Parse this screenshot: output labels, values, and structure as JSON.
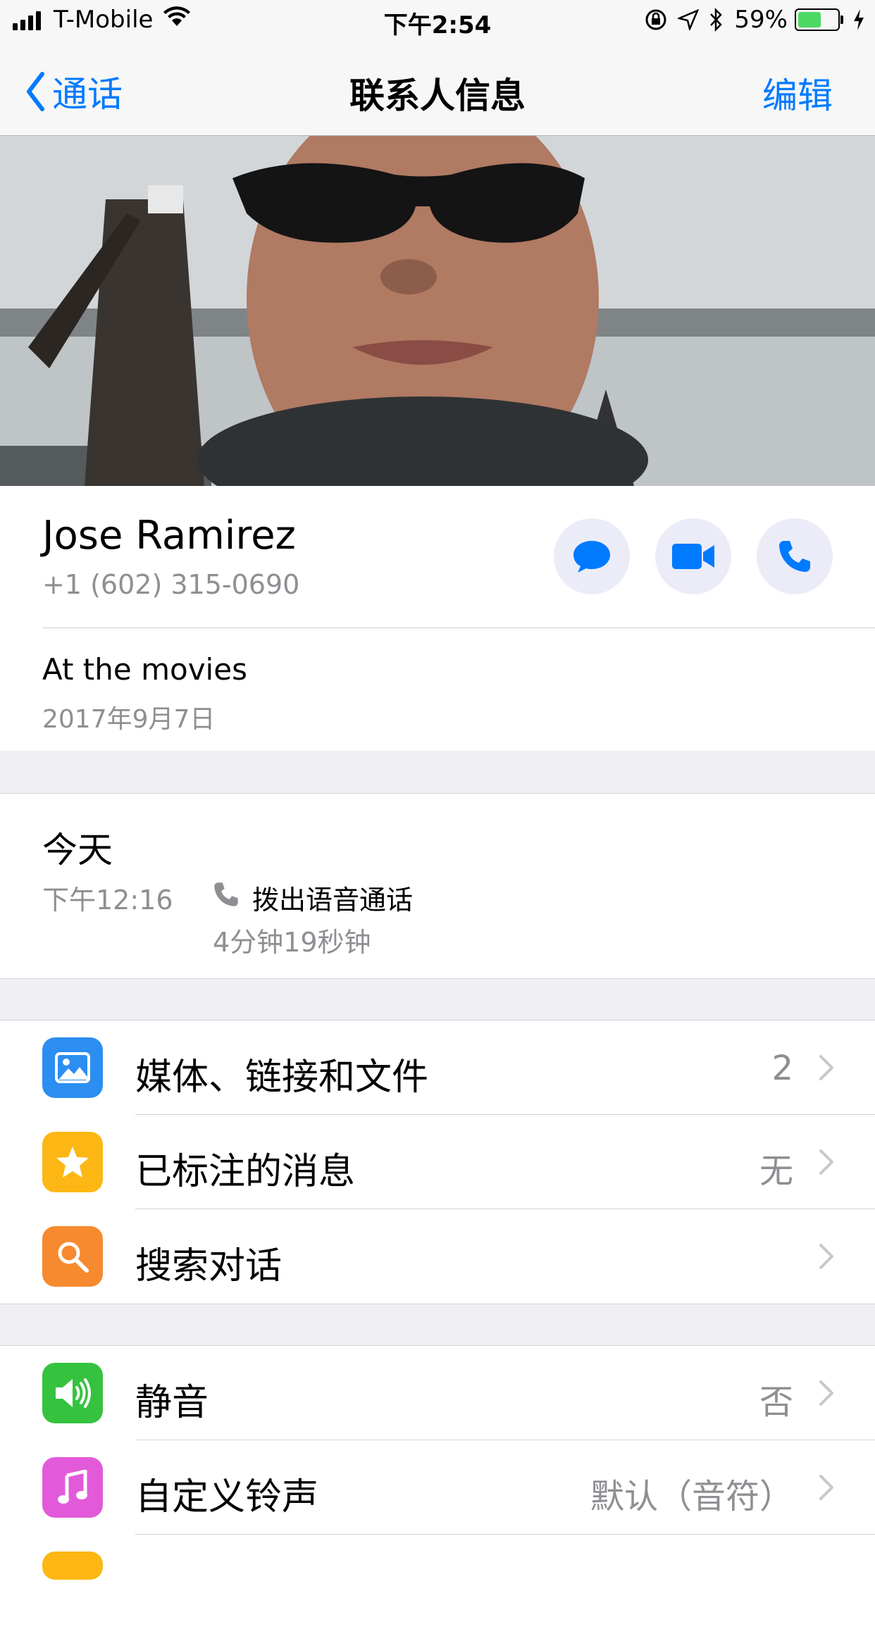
{
  "status_bar": {
    "carrier": "T-Mobile",
    "time": "下午2:54",
    "battery": "59%",
    "battery_level": 0.59
  },
  "nav": {
    "back_label": "通话",
    "title": "联系人信息",
    "edit_label": "编辑"
  },
  "contact": {
    "name": "Jose Ramirez",
    "phone": "+1 (602) 315-0690",
    "status": "At the movies",
    "status_date": "2017年9月7日"
  },
  "actions": [
    {
      "icon": "message-icon"
    },
    {
      "icon": "video-icon"
    },
    {
      "icon": "phone-icon"
    }
  ],
  "call_history": {
    "day": "今天",
    "time": "下午12:16",
    "type": "拨出语音通话",
    "duration": "4分钟19秒钟"
  },
  "group1": [
    {
      "label": "媒体、链接和文件",
      "value": "2",
      "icon": "photo-icon",
      "color": "#2b8ef0"
    },
    {
      "label": "已标注的消息",
      "value": "无",
      "icon": "star-icon",
      "color": "#fdb714"
    },
    {
      "label": "搜索对话",
      "value": "",
      "icon": "search-icon",
      "color": "#f7892e"
    }
  ],
  "group2": [
    {
      "label": "静音",
      "value": "否",
      "icon": "speaker-icon",
      "color": "#35c33f"
    },
    {
      "label": "自定义铃声",
      "value": "默认（音符）",
      "icon": "music-note-icon",
      "color": "#e25ad9"
    }
  ],
  "colors": {
    "accent": "#007aff",
    "battery_green": "#4cd964"
  }
}
